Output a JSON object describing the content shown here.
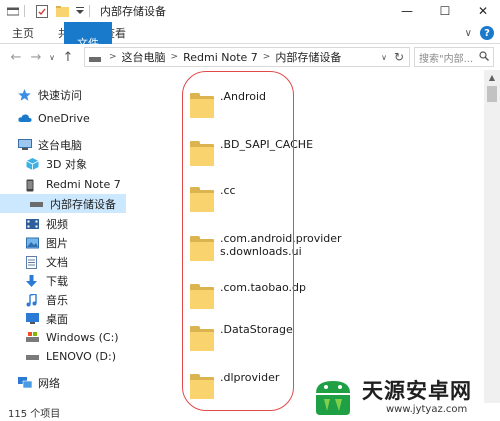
{
  "window": {
    "title": "内部存储设备",
    "controls": {
      "minimize": "—",
      "maximize": "☐",
      "close": "✕"
    }
  },
  "ribbon": {
    "tabs": [
      "文件",
      "主页",
      "共享",
      "查看"
    ],
    "collapse": "∨",
    "help": "?"
  },
  "address": {
    "back": "←",
    "forward": "→",
    "recent": "∨",
    "up": "↑",
    "crumbs": [
      "这台电脑",
      "Redmi Note 7",
      "内部存储设备"
    ],
    "dropdown": "∨",
    "refresh": "↻",
    "search_placeholder": "搜索\"内部...",
    "search_icon": "magnifier-icon"
  },
  "nav": {
    "items": [
      {
        "label": "快速访问",
        "icon": "star-icon"
      },
      {
        "label": "OneDrive",
        "icon": "cloud-icon"
      },
      {
        "label": "这台电脑",
        "icon": "computer-icon"
      },
      {
        "label": "3D 对象",
        "icon": "cube-icon"
      },
      {
        "label": "Redmi Note 7",
        "icon": "phone-icon"
      },
      {
        "label": "内部存储设备",
        "icon": "storage-icon"
      },
      {
        "label": "视频",
        "icon": "video-icon"
      },
      {
        "label": "图片",
        "icon": "picture-icon"
      },
      {
        "label": "文档",
        "icon": "document-icon"
      },
      {
        "label": "下载",
        "icon": "download-icon"
      },
      {
        "label": "音乐",
        "icon": "music-icon"
      },
      {
        "label": "桌面",
        "icon": "desktop-icon"
      },
      {
        "label": "Windows (C:)",
        "icon": "drive-icon"
      },
      {
        "label": "LENOVO (D:)",
        "icon": "drive-icon"
      },
      {
        "label": "网络",
        "icon": "network-icon"
      }
    ]
  },
  "files": [
    {
      "name": ".Android"
    },
    {
      "name": ".BD_SAPI_CACHE"
    },
    {
      "name": ".cc"
    },
    {
      "name": ".com.android.provider",
      "name2": "s.downloads.ui"
    },
    {
      "name": ".com.taobao.dp"
    },
    {
      "name": ".DataStorage"
    },
    {
      "name": ".dlprovider"
    }
  ],
  "status": {
    "count": "115 个项目"
  },
  "watermark": {
    "title": "天源安卓网",
    "url": "www.jytyaz.com"
  },
  "colors": {
    "accent": "#1979ca",
    "selected": "#cce8ff",
    "folder_front": "#f9d46e",
    "folder_back": "#dcb44f",
    "annotation": "#e04a4a"
  }
}
